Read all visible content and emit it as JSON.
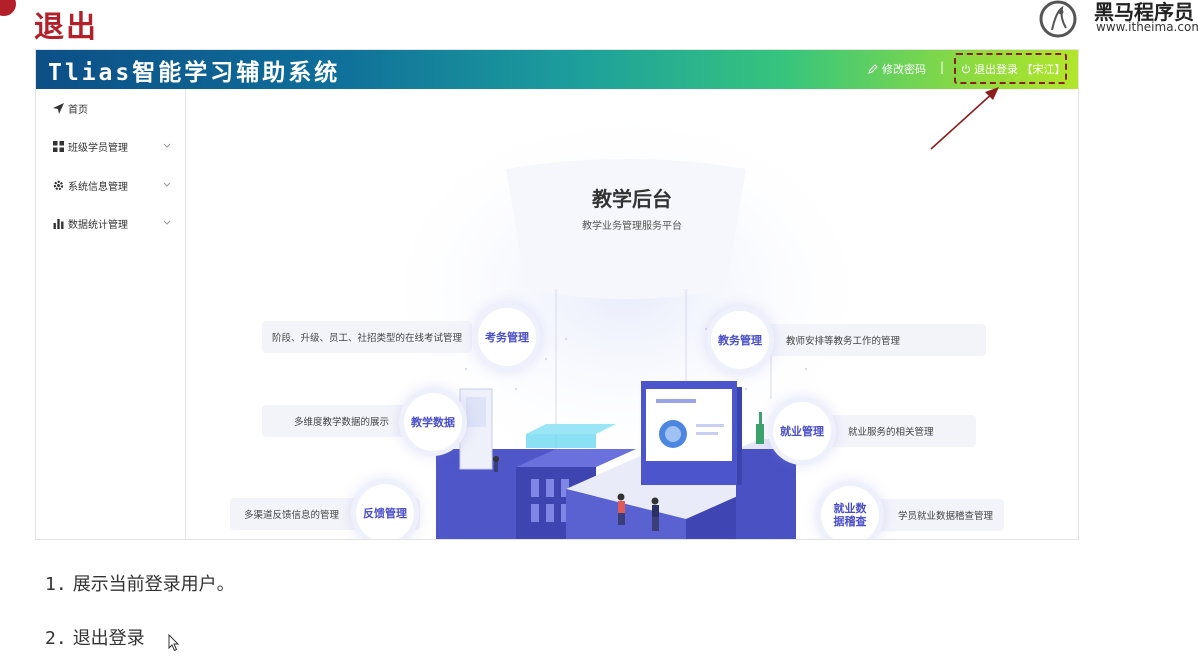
{
  "slide": {
    "title": "退出",
    "brand_name": "黑马程序员",
    "brand_url": "www.itheima.com"
  },
  "app": {
    "title": "Tlias智能学习辅助系统",
    "header": {
      "change_password": "修改密码",
      "separator": "|",
      "logout": "退出登录 【宋江】"
    },
    "sidebar": {
      "items": [
        {
          "label": "首页",
          "icon": "send-icon",
          "expandable": false
        },
        {
          "label": "班级学员管理",
          "icon": "grid-icon",
          "expandable": true
        },
        {
          "label": "系统信息管理",
          "icon": "gear-icon",
          "expandable": true
        },
        {
          "label": "数据统计管理",
          "icon": "bar-chart-icon",
          "expandable": true
        }
      ]
    },
    "main": {
      "hero_title": "教学后台",
      "hero_subtitle": "教学业务管理服务平台",
      "features": [
        {
          "name": "考务管理",
          "desc": "阶段、升级、员工、社招类型的在线考试管理"
        },
        {
          "name": "教学数据",
          "desc": "多维度教学数据的展示"
        },
        {
          "name": "反馈管理",
          "desc": "多渠道反馈信息的管理"
        },
        {
          "name": "教务管理",
          "desc": "教师安排等教务工作的管理"
        },
        {
          "name": "就业管理",
          "desc": "就业服务的相关管理"
        },
        {
          "name": "就业数据稽查",
          "desc": "学员就业数据稽查管理"
        }
      ]
    }
  },
  "steps": [
    {
      "num": "1.",
      "text": "展示当前登录用户。"
    },
    {
      "num": "2.",
      "text": "退出登录"
    }
  ],
  "colors": {
    "accent_red": "#b3202a",
    "feature_text": "#4a4fc8",
    "annotation_border": "#8c1d1d"
  }
}
